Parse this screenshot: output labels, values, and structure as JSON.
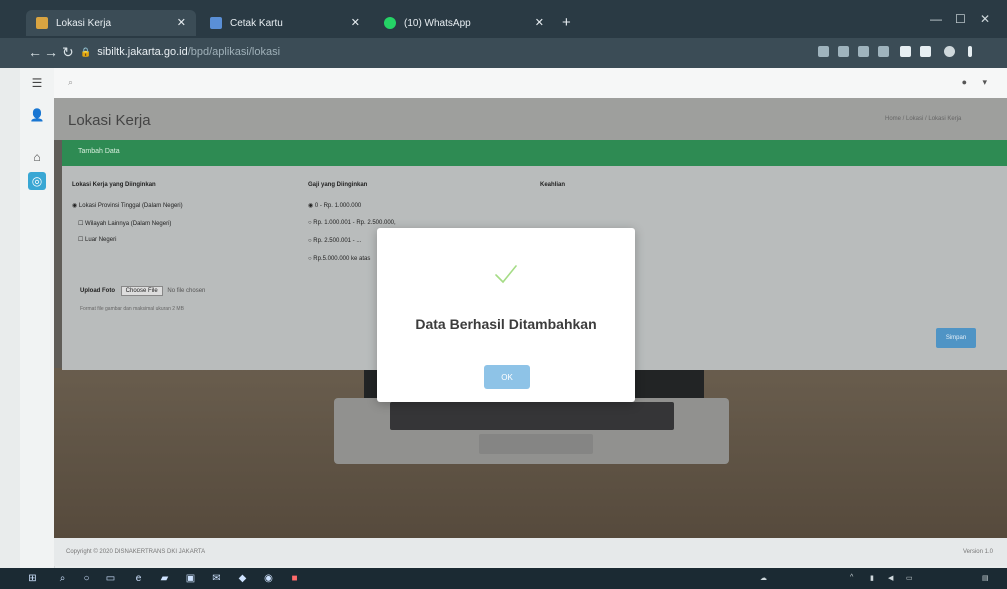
{
  "browser": {
    "tabs": [
      {
        "label": "Lokasi Kerja",
        "active": true
      },
      {
        "label": "Cetak Kartu",
        "active": false
      },
      {
        "label": "(10) WhatsApp",
        "active": false
      }
    ],
    "url_main": "sibiltk.jakarta.go.id",
    "url_path": "/bpd/aplikasi/lokasi"
  },
  "page": {
    "title": "Lokasi Kerja",
    "breadcrumb": "Home / Lokasi / Lokasi Kerja",
    "section_header": "Tambah Data",
    "col1_title": "Lokasi Kerja yang Diinginkan",
    "col1_items": [
      "Lokasi Provinsi Tinggal (Dalam Negeri)",
      "Wilayah Lainnya (Dalam Negeri)",
      "Luar Negeri"
    ],
    "col2_title": "Gaji yang Diinginkan",
    "col2_items": [
      "0 - Rp. 1.000.000",
      "Rp. 1.000.001 - Rp. 2.500.000,",
      "Rp. 2.500.001 - ...",
      "Rp.5.000.000 ke atas"
    ],
    "col3_title": "Keahlian",
    "upload_label": "Upload Foto",
    "upload_button": "Choose File",
    "upload_status": "No file chosen",
    "upload_hint": "Format file gambar dan maksimal ukuran 2 MB",
    "save_label": "Simpan",
    "footer_left": "Copyright © 2020 DISNAKERTRANS DKI JAKARTA",
    "footer_right": "Version 1.0"
  },
  "modal": {
    "title": "Data Berhasil Ditambahkan",
    "ok_label": "OK",
    "check_color": "#a5dc86"
  },
  "colors": {
    "accent_green": "#2e8b53",
    "accent_blue": "#4f94c5",
    "chrome_dark": "#2a3a44"
  }
}
